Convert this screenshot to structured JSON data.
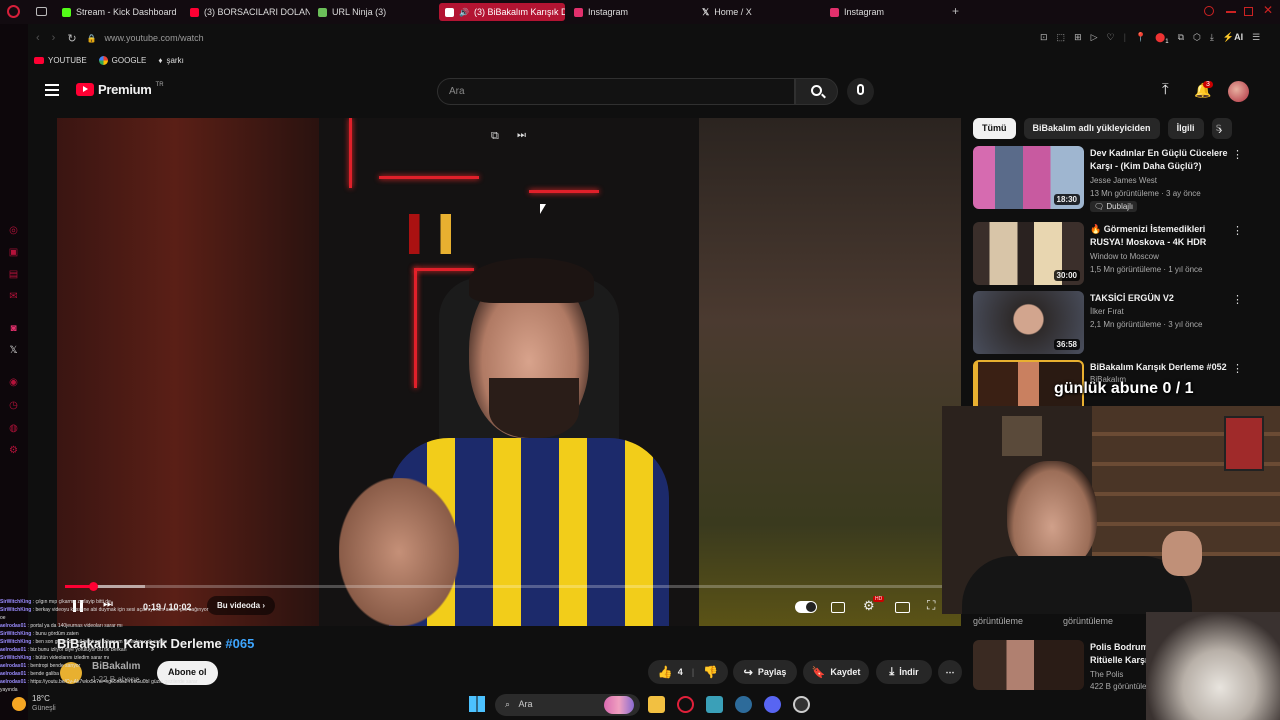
{
  "browser": {
    "tabs": [
      {
        "label": "Stream - Kick Dashboard",
        "color": "#53fc18"
      },
      {
        "label": "(3) BORSACILARI DOLANI",
        "color": "#ff0033"
      },
      {
        "label": "URL Ninja (3)",
        "color": "#6bbf59"
      },
      {
        "label": "(3) BiBakalım Karışık D",
        "color": "#ff0033"
      },
      {
        "label": "Instagram",
        "color": "#e1306c"
      },
      {
        "label": "Home / X",
        "color": "#ffffff"
      },
      {
        "label": "Instagram",
        "color": "#e1306c"
      }
    ],
    "url": "www.youtube.com/watch",
    "bookmarks": [
      {
        "label": "YOUTUBE",
        "icon": "youtube-icon"
      },
      {
        "label": "GOOGLE",
        "icon": "google-icon"
      },
      {
        "label": "şarkı",
        "icon": "music-icon"
      }
    ],
    "ai_label": "AI",
    "extension_badge": "1"
  },
  "youtube": {
    "logo_text": "Premium",
    "logo_region": "TR",
    "search_placeholder": "Ara",
    "notif_count": "3",
    "brand_color": "#ff0033"
  },
  "player": {
    "time": "0:19 / 10:02",
    "chapter_label": "Bu videoda",
    "progress": 0.032,
    "buffered": 0.09,
    "hd_badge": "HD"
  },
  "video": {
    "title": "BiBakalım Karışık Derleme",
    "hashtag": "#065",
    "channel": "BiBakalım",
    "subscribers": "1,22 B abone",
    "subscribe_label": "Abone ol",
    "likes": "4",
    "share_label": "Paylaş",
    "save_label": "Kaydet",
    "download_label": "İndir"
  },
  "sidebar_right": {
    "chips": [
      "Tümü",
      "BiBakalım adlı yükleyiciden",
      "İlgili",
      "S"
    ],
    "recommendations": [
      {
        "title": "Dev Kadınlar En Güçlü Cücelere Karşı - (Kim Daha Güçlü?)",
        "channel": "Jesse James West",
        "meta": "13 Mn görüntüleme · 3 ay önce",
        "badge": "Dublajlı",
        "duration": "18:30"
      },
      {
        "title": "🔥 Görmenizi İstemedikleri RUSYA! Moskova - 4K HDR",
        "channel": "Window to Moscow",
        "meta": "1,5 Mn görüntüleme · 1 yıl önce",
        "duration": "30:00"
      },
      {
        "title": "TAKSİCİ ERGÜN V2",
        "channel": "İlker Fırat",
        "meta": "2,1 Mn görüntüleme · 3 yıl önce",
        "duration": "36:58"
      },
      {
        "title": "BiBakalım Karışık Derleme #052",
        "channel": "BiBakalım",
        "meta": "",
        "duration": ""
      },
      {
        "title": "Polis Bodrum Ritüelle Karşı",
        "channel": "The Polis",
        "meta": "422 B görüntüle",
        "duration": ""
      }
    ],
    "partial_meta_left": "görüntüleme",
    "partial_meta_right": "görüntüleme"
  },
  "overlay": {
    "sub_goal": "günlük abune 0 / 1"
  },
  "chat": [
    {
      "user": "SirWitchKing",
      "msg": "çılgın mıp çikarma zorlayip bitti de"
    },
    {
      "user": "SirWitchKing",
      "msg": "berkay videoyu kessene abi duymak için sesi açamıyorum adam çok bağırıyor oe"
    },
    {
      "user": "aelrodas01",
      "msg": "portal ya da 140jeurnas videoları sarar mı"
    },
    {
      "user": "SirWitchKing",
      "msg": "bunu gördüm zaten"
    },
    {
      "user": "SirWitchKing",
      "msg": "ben son günlerde full bentropi izliyorum videoları çok sarıyo"
    },
    {
      "user": "aelrodas01",
      "msg": "biz bunu izliyor diye yoruluyor bu tik Berkan"
    },
    {
      "user": "SirWitchKing",
      "msg": "bütün videolarını izledim sarar mı"
    },
    {
      "user": "aelrodas01",
      "msg": "bentropi bende sarıyor"
    },
    {
      "user": "aelrodas01",
      "msg": "bende galiba"
    },
    {
      "user": "aelrodas01",
      "msg": "https://youtu.be/Cv-Ak7wkx5c?si=hg65n5s2Y9sGu0bI güzle gezilerde sarar yayında"
    }
  ],
  "taskbar": {
    "weather": "18°C",
    "weather_label": "Güneşli",
    "search_label": "Ara"
  }
}
